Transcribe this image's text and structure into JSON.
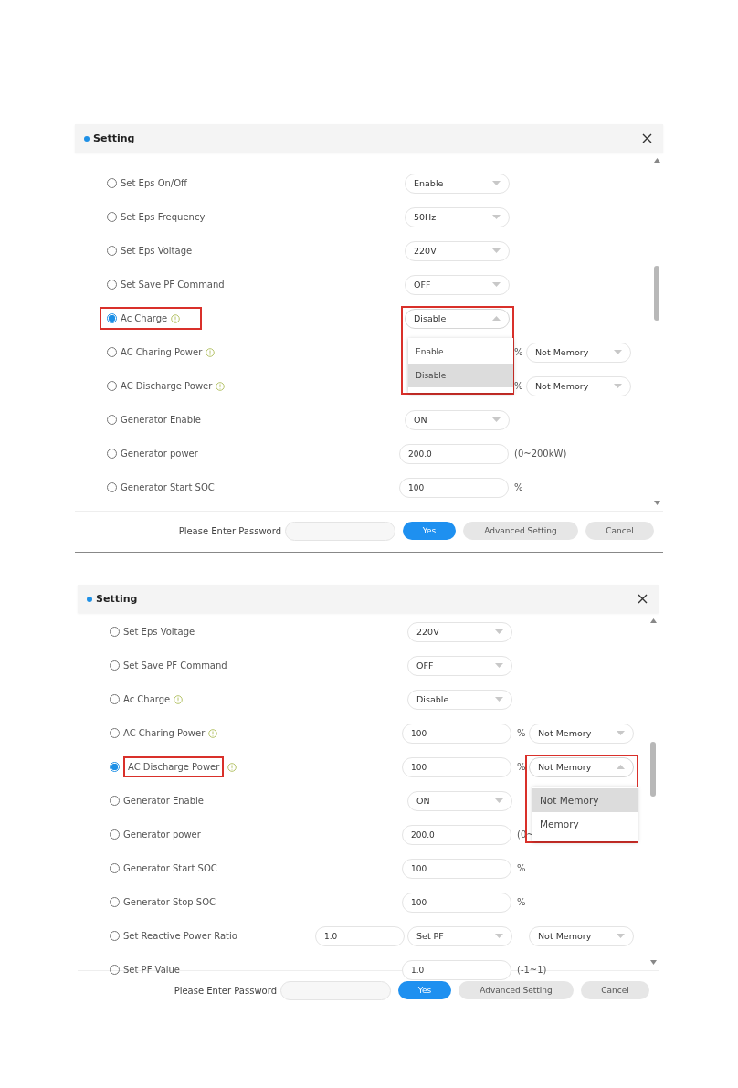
{
  "dialogs": [
    {
      "title": "Setting",
      "rows": [
        {
          "label": "Set Eps On/Off",
          "info": false,
          "selected": false,
          "highlighted": false,
          "main": {
            "kind": "select",
            "value": "Enable",
            "open": false
          }
        },
        {
          "label": "Set Eps Frequency",
          "info": false,
          "selected": false,
          "highlighted": false,
          "main": {
            "kind": "select",
            "value": "50Hz",
            "open": false
          }
        },
        {
          "label": "Set Eps Voltage",
          "info": false,
          "selected": false,
          "highlighted": false,
          "main": {
            "kind": "select",
            "value": "220V",
            "open": false
          }
        },
        {
          "label": "Set Save PF Command",
          "info": false,
          "selected": false,
          "highlighted": false,
          "main": {
            "kind": "select",
            "value": "OFF",
            "open": false
          }
        },
        {
          "label": "Ac Charge",
          "info": true,
          "selected": true,
          "highlighted": true,
          "main": {
            "kind": "select",
            "value": "Disable",
            "open": true,
            "options": [
              {
                "label": "Enable",
                "selected": false
              },
              {
                "label": "Disable",
                "selected": true
              }
            ]
          }
        },
        {
          "label": "AC Charing Power",
          "info": true,
          "selected": false,
          "highlighted": false,
          "unit": "%",
          "memory": {
            "kind": "select",
            "value": "Not Memory",
            "open": false
          }
        },
        {
          "label": "AC Discharge Power",
          "info": true,
          "selected": false,
          "highlighted": false,
          "unit": "%",
          "memory": {
            "kind": "select",
            "value": "Not Memory",
            "open": false
          }
        },
        {
          "label": "Generator Enable",
          "info": false,
          "selected": false,
          "highlighted": false,
          "main": {
            "kind": "select",
            "value": "ON",
            "open": false
          }
        },
        {
          "label": "Generator power",
          "info": false,
          "selected": false,
          "highlighted": false,
          "main": {
            "kind": "input",
            "value": "200.0"
          },
          "unit": "(0~200kW)"
        },
        {
          "label": "Generator Start SOC",
          "info": false,
          "selected": false,
          "highlighted": false,
          "main": {
            "kind": "input",
            "value": "100"
          },
          "unit": "%"
        }
      ],
      "footer": {
        "password_label": "Please Enter Password",
        "buttons": [
          {
            "label": "Yes",
            "kind": "primary"
          },
          {
            "label": "Advanced Setting",
            "kind": "secondary"
          },
          {
            "label": "Cancel",
            "kind": "secondary"
          }
        ]
      }
    },
    {
      "title": "Setting",
      "rows": [
        {
          "label": "Set Eps Voltage",
          "info": false,
          "selected": false,
          "highlighted": false,
          "main": {
            "kind": "select",
            "value": "220V",
            "open": false
          }
        },
        {
          "label": "Set Save PF Command",
          "info": false,
          "selected": false,
          "highlighted": false,
          "main": {
            "kind": "select",
            "value": "OFF",
            "open": false
          }
        },
        {
          "label": "Ac Charge",
          "info": true,
          "selected": false,
          "highlighted": false,
          "main": {
            "kind": "select",
            "value": "Disable",
            "open": false
          }
        },
        {
          "label": "AC Charing Power",
          "info": true,
          "selected": false,
          "highlighted": false,
          "main": {
            "kind": "input",
            "value": "100"
          },
          "unit": "%",
          "memory": {
            "kind": "select",
            "value": "Not Memory",
            "open": false
          }
        },
        {
          "label": "AC Discharge Power",
          "info": true,
          "selected": true,
          "highlighted": true,
          "main": {
            "kind": "input",
            "value": "100"
          },
          "unit": "%",
          "memory": {
            "kind": "select",
            "value": "Not Memory",
            "open": true,
            "options": [
              {
                "label": "Not Memory",
                "selected": true
              },
              {
                "label": "Memory",
                "selected": false
              }
            ]
          }
        },
        {
          "label": "Generator Enable",
          "info": false,
          "selected": false,
          "highlighted": false,
          "main": {
            "kind": "select",
            "value": "ON",
            "open": false
          }
        },
        {
          "label": "Generator power",
          "info": false,
          "selected": false,
          "highlighted": false,
          "main": {
            "kind": "input",
            "value": "200.0"
          },
          "unit": "(0~"
        },
        {
          "label": "Generator Start SOC",
          "info": false,
          "selected": false,
          "highlighted": false,
          "main": {
            "kind": "input",
            "value": "100"
          },
          "unit": "%"
        },
        {
          "label": "Generator Stop SOC",
          "info": false,
          "selected": false,
          "highlighted": false,
          "main": {
            "kind": "input",
            "value": "100"
          },
          "unit": "%"
        },
        {
          "label": "Set Reactive Power Ratio",
          "info": false,
          "selected": false,
          "highlighted": false,
          "ratio": "1.0",
          "main": {
            "kind": "select",
            "value": "Set PF",
            "open": false
          },
          "memory": {
            "kind": "select",
            "value": "Not Memory",
            "open": false
          }
        },
        {
          "label": "Set PF Value",
          "info": false,
          "selected": false,
          "highlighted": false,
          "main": {
            "kind": "input",
            "value": "1.0"
          },
          "unit": "(-1~1)"
        }
      ],
      "footer": {
        "password_label": "Please Enter Password",
        "buttons": [
          {
            "label": "Yes",
            "kind": "primary"
          },
          {
            "label": "Advanced Setting",
            "kind": "secondary"
          },
          {
            "label": "Cancel",
            "kind": "secondary"
          }
        ]
      }
    }
  ]
}
